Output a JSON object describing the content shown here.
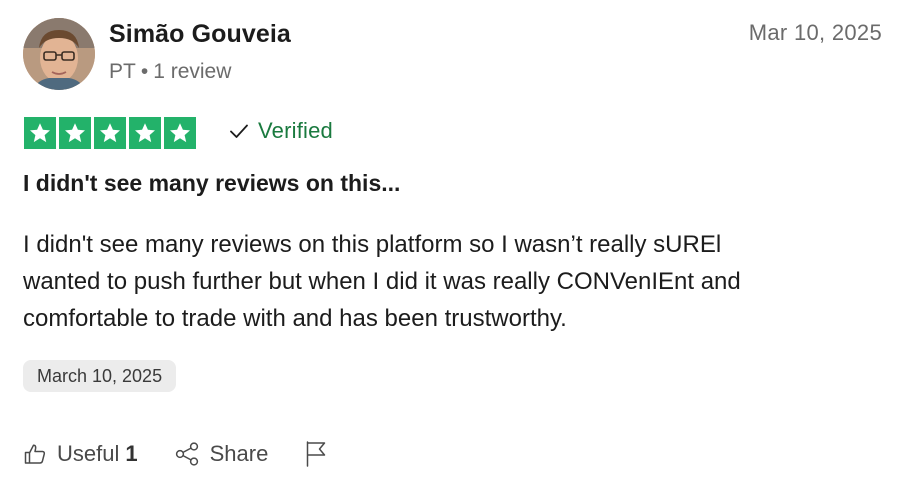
{
  "reviewer": {
    "name": "Simão Gouveia",
    "country": "PT",
    "separator": "•",
    "review_count": "1 review"
  },
  "review": {
    "date_top": "Mar 10, 2025",
    "rating": 5,
    "star_color": "#23b26a",
    "verified_label": "Verified",
    "verified_color": "#1a7a3f",
    "title": "I didn't see many reviews on this...",
    "body_lines": [
      "I didn't see many reviews on this platform so I wasn’t really sUREl",
      "wanted to push further but when I did it was really CONVenIEnt and",
      "comfortable to trade with and has been trustworthy."
    ],
    "date_chip": "March 10, 2025"
  },
  "actions": {
    "useful_label": "Useful",
    "useful_count": "1",
    "share_label": "Share"
  },
  "icons": {
    "useful": "thumbs-up-icon",
    "share": "share-icon",
    "report": "flag-icon",
    "verified": "checkmark-icon",
    "star": "star-icon"
  }
}
